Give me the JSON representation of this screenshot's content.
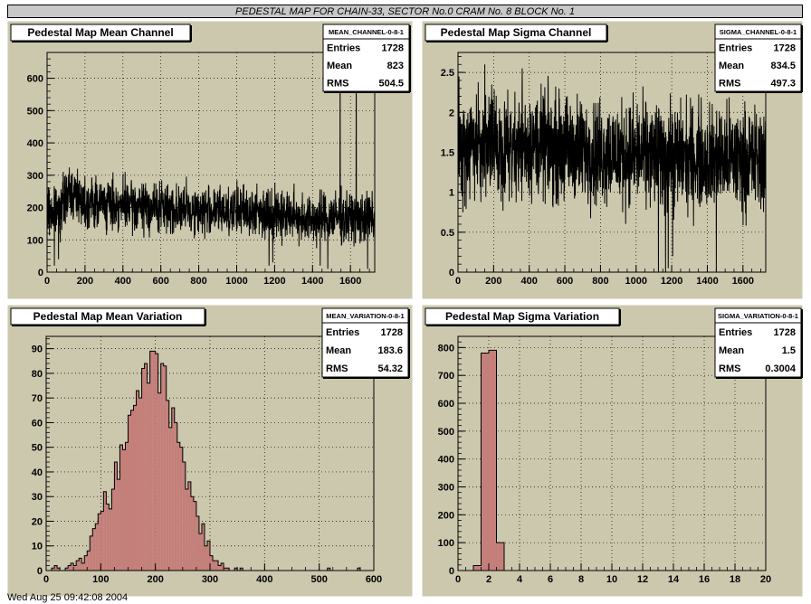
{
  "page_title": "PEDESTAL MAP FOR CHAIN-33, SECTOR No.0 CRAM No. 8 BLOCK No. 1",
  "bottom_stamp": "Wed Aug 25 09:42:08 2004",
  "colors": {
    "pad": "#ccc8ae",
    "frame": "#ccc8ae",
    "hist_fill": "#c47f7a",
    "line": "#000000"
  },
  "chart_data": [
    {
      "id": "mean-channel",
      "type": "line",
      "title": "Pedestal Map Mean Channel",
      "stats": {
        "name": "MEAN_CHANNEL-0-8-1",
        "rows": [
          [
            "Entries",
            "1728"
          ],
          [
            "Mean",
            "823"
          ],
          [
            "RMS",
            "504.5"
          ]
        ]
      },
      "xlim": [
        0,
        1728
      ],
      "ylim": [
        0,
        680
      ],
      "xticks": [
        0,
        200,
        400,
        600,
        800,
        1000,
        1200,
        1400,
        1600
      ],
      "yticks": [
        0,
        100,
        200,
        300,
        400,
        500,
        600
      ],
      "grid": true,
      "profile": {
        "n": 1728,
        "segments": [
          [
            0,
            190
          ],
          [
            50,
            180
          ],
          [
            120,
            250
          ],
          [
            200,
            220
          ],
          [
            400,
            205
          ],
          [
            600,
            200
          ],
          [
            800,
            190
          ],
          [
            1000,
            190
          ],
          [
            1200,
            185
          ],
          [
            1400,
            165
          ],
          [
            1500,
            170
          ],
          [
            1728,
            165
          ]
        ],
        "noise": 38,
        "seed": 7,
        "spikes": [
          [
            38,
            20
          ],
          [
            60,
            40
          ],
          [
            160,
            320
          ],
          [
            1170,
            20
          ],
          [
            1190,
            30
          ],
          [
            1440,
            20
          ],
          [
            1480,
            10
          ],
          [
            1630,
            680
          ],
          [
            1690,
            10
          ],
          [
            1545,
            700
          ]
        ]
      }
    },
    {
      "id": "sigma-channel",
      "type": "line",
      "title": "Pedestal Map Sigma Channel",
      "stats": {
        "name": "SIGMA_CHANNEL-0-8-1",
        "rows": [
          [
            "Entries",
            "1728"
          ],
          [
            "Mean",
            "834.5"
          ],
          [
            "RMS",
            "497.3"
          ]
        ]
      },
      "xlim": [
        0,
        1728
      ],
      "ylim": [
        0,
        2.75
      ],
      "xticks": [
        0,
        200,
        400,
        600,
        800,
        1000,
        1200,
        1400,
        1600
      ],
      "yticks": [
        0,
        0.5,
        1,
        1.5,
        2,
        2.5
      ],
      "grid": true,
      "profile": {
        "n": 1728,
        "segments": [
          [
            0,
            1.55
          ],
          [
            400,
            1.6
          ],
          [
            800,
            1.5
          ],
          [
            1200,
            1.45
          ],
          [
            1728,
            1.4
          ]
        ],
        "noise": 0.32,
        "seed": 19,
        "spikes": [
          [
            5,
            2.45
          ],
          [
            150,
            2.6
          ],
          [
            360,
            2.55
          ],
          [
            1125,
            0.0
          ],
          [
            1165,
            0.0
          ],
          [
            1180,
            0.05
          ],
          [
            1205,
            0.2
          ],
          [
            1450,
            0.0
          ]
        ]
      }
    },
    {
      "id": "mean-variation",
      "type": "bar",
      "title": "Pedestal Map Mean Variation",
      "stats": {
        "name": "MEAN_VARIATION-0-8-1",
        "rows": [
          [
            "Entries",
            "1728"
          ],
          [
            "Mean",
            "183.6"
          ],
          [
            "RMS",
            "54.32"
          ]
        ]
      },
      "xlim": [
        0,
        600
      ],
      "ylim": [
        0,
        95
      ],
      "xticks": [
        0,
        100,
        200,
        300,
        400,
        500,
        600
      ],
      "yticks": [
        0,
        10,
        20,
        30,
        40,
        50,
        60,
        70,
        80,
        90
      ],
      "grid": true,
      "bin_width": 5,
      "bins_start": 5,
      "values": [
        0,
        1,
        2,
        1,
        0,
        0,
        1,
        2,
        3,
        2,
        4,
        5,
        3,
        6,
        8,
        14,
        17,
        19,
        23,
        24,
        32,
        27,
        25,
        33,
        44,
        37,
        51,
        49,
        52,
        63,
        65,
        67,
        73,
        70,
        82,
        84,
        76,
        89,
        89,
        88,
        72,
        84,
        83,
        69,
        58,
        66,
        60,
        52,
        50,
        44,
        33,
        36,
        30,
        28,
        22,
        15,
        19,
        10,
        12,
        6,
        4,
        4,
        2,
        3,
        1,
        1,
        0,
        0,
        1,
        0,
        1,
        0,
        0,
        0,
        0,
        0,
        0,
        0,
        0,
        0,
        0,
        0,
        0,
        0,
        0,
        0,
        0,
        0,
        0,
        0,
        0,
        0,
        0,
        0,
        0,
        0,
        0,
        0,
        0,
        0,
        0,
        0,
        1,
        0,
        0,
        0,
        0,
        0,
        0,
        0,
        0,
        0,
        0,
        1
      ]
    },
    {
      "id": "sigma-variation",
      "type": "bar",
      "title": "Pedestal Map Sigma Variation",
      "stats": {
        "name": "SIGMA_VARIATION-0-8-1",
        "rows": [
          [
            "Entries",
            "1728"
          ],
          [
            "Mean",
            "1.5"
          ],
          [
            "RMS",
            "0.3004"
          ]
        ]
      },
      "xlim": [
        0,
        20
      ],
      "ylim": [
        0,
        840
      ],
      "xticks": [
        0,
        2,
        4,
        6,
        8,
        10,
        12,
        14,
        16,
        18,
        20
      ],
      "yticks": [
        0,
        100,
        200,
        300,
        400,
        500,
        600,
        700,
        800
      ],
      "grid": true,
      "bin_width": 0.5,
      "bins_start": 0,
      "values": [
        0,
        0,
        18,
        780,
        790,
        100,
        0
      ]
    }
  ]
}
